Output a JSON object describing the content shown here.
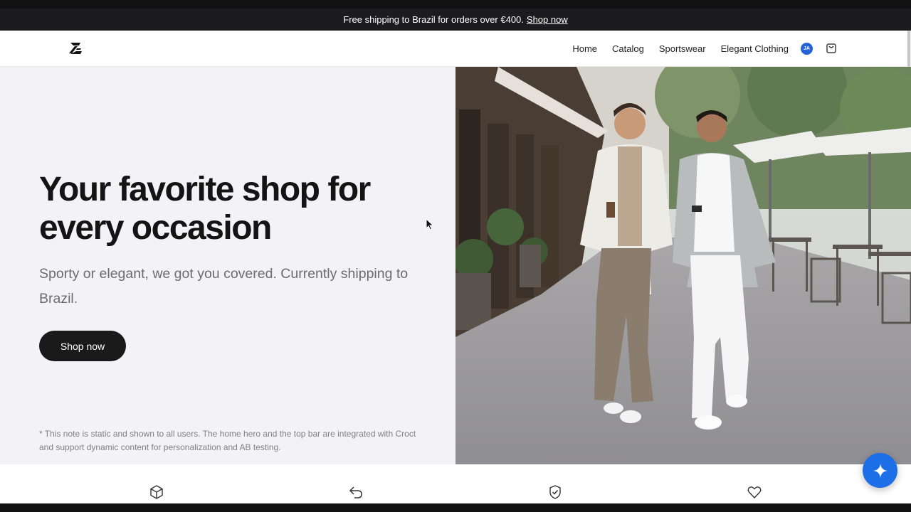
{
  "announcement": {
    "text": "Free shipping to Brazil for orders over €400.",
    "link": "Shop now"
  },
  "nav": {
    "logo_icon": "store-logo-icon",
    "links": [
      "Home",
      "Catalog",
      "Sportswear",
      "Elegant Clothing"
    ],
    "avatar_initials": "JA",
    "cart_icon": "shopping-bag-icon"
  },
  "hero": {
    "title": "Your favorite shop for every occasion",
    "subtitle": "Sporty or elegant, we got you covered. Currently shipping to Brazil.",
    "cta": "Shop now",
    "note": "* This note is static and shown to all users. The home hero and the top bar are integrated with Croct and support dynamic content for personalization and AB testing.",
    "image_icon": "hero-photo-two-men-walking"
  },
  "features": {
    "icons": [
      "box-icon",
      "return-arrow-icon",
      "shield-check-icon",
      "heart-icon"
    ]
  },
  "fab_icon": "sparkle-icon",
  "colors": {
    "announcement_bg": "#1c1c1e",
    "hero_bg": "#f3f3f5",
    "button_bg": "#1a1a1a",
    "accent_blue": "#1d6fe8",
    "avatar_blue": "#2563d6"
  }
}
